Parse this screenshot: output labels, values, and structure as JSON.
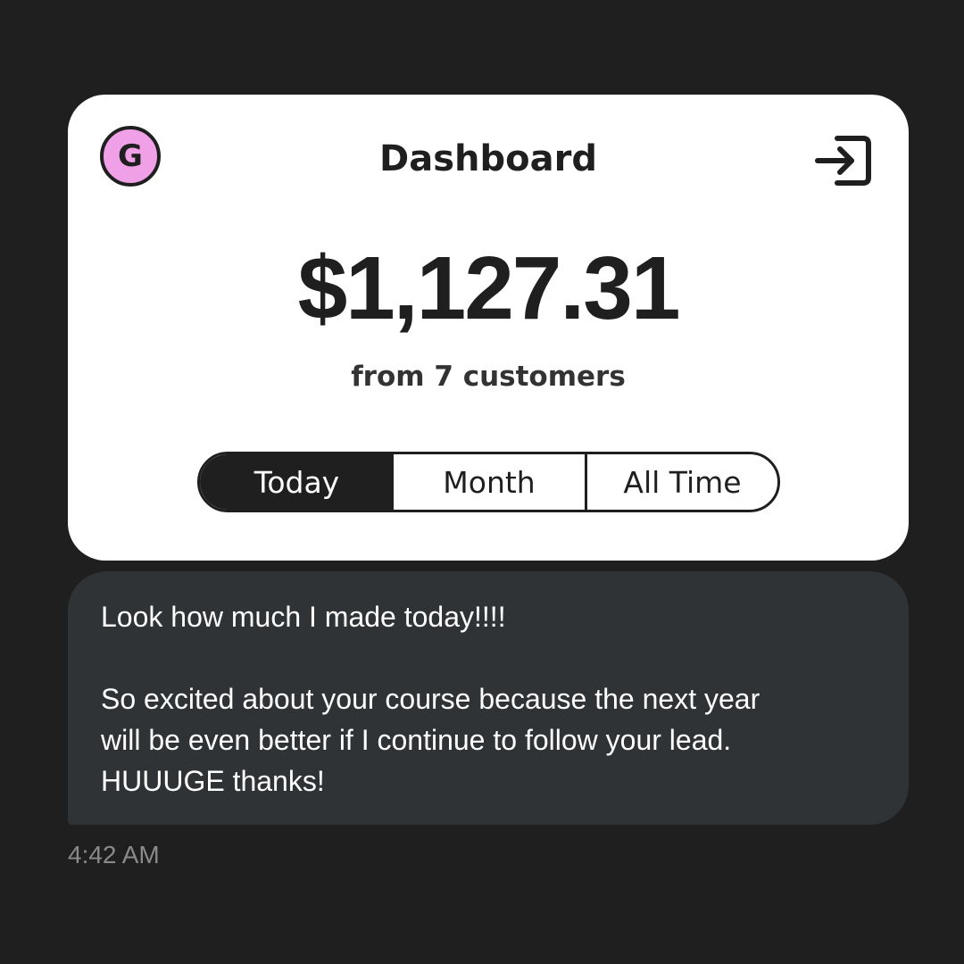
{
  "dashboard": {
    "logo_letter": "G",
    "title": "Dashboard",
    "logout_icon": "logout-icon",
    "amount": "$1,127.31",
    "subtitle": "from 7 customers",
    "tabs": [
      {
        "label": "Today",
        "selected": true
      },
      {
        "label": "Month",
        "selected": false
      },
      {
        "label": "All Time",
        "selected": false
      }
    ],
    "colors": {
      "logo_background": "#f0a0e6",
      "card_background": "#ffffff",
      "selected_tab_background": "#1f1f1f"
    }
  },
  "message": {
    "lines": [
      "Look how much I made today!!!!",
      "So excited about your course because the next year",
      "will be even better if I continue to follow your lead.",
      "HUUUGE thanks!"
    ],
    "timestamp": "4:42 AM",
    "bubble_color": "#303336"
  }
}
